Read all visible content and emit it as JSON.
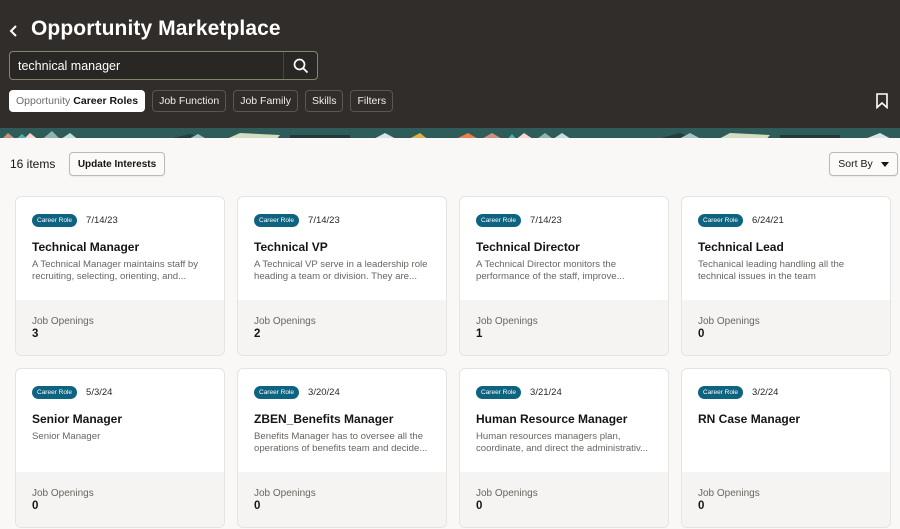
{
  "header": {
    "title": "Opportunity Marketplace",
    "back_icon": "chevron-left-icon",
    "bookmark_icon": "bookmark-icon",
    "background_color": "#312d2a"
  },
  "search": {
    "value": "technical manager",
    "icon": "search-icon"
  },
  "filters": [
    {
      "prefix": "Opportunity",
      "label": "Career Roles",
      "active": true
    },
    {
      "label": "Job Function",
      "active": false
    },
    {
      "label": "Job Family",
      "active": false
    },
    {
      "label": "Skills",
      "active": false
    },
    {
      "label": "Filters",
      "active": false
    }
  ],
  "toolbar": {
    "item_count": "16 items",
    "update_interests_label": "Update Interests",
    "sort_label": "Sort By"
  },
  "colors": {
    "badge": "#0d6380",
    "card_footer": "#f5f4f2"
  },
  "cards": [
    {
      "badge": "Career Role",
      "date": "7/14/23",
      "title": "Technical Manager",
      "description": "A Technical Manager maintains staff by recruiting, selecting, orienting, and...",
      "openings_label": "Job Openings",
      "openings": "3"
    },
    {
      "badge": "Career Role",
      "date": "7/14/23",
      "title": "Technical VP",
      "description": "A Technical VP serve in a leadership role heading a team or division. They are...",
      "openings_label": "Job Openings",
      "openings": "2"
    },
    {
      "badge": "Career Role",
      "date": "7/14/23",
      "title": "Technical Director",
      "description": "A Technical Director monitors the performance of the staff, improve...",
      "openings_label": "Job Openings",
      "openings": "1"
    },
    {
      "badge": "Career Role",
      "date": "6/24/21",
      "title": "Technical Lead",
      "description": "Techanical leading handling all the technical issues in the team",
      "openings_label": "Job Openings",
      "openings": "0"
    },
    {
      "badge": "Career Role",
      "date": "5/3/24",
      "title": "Senior Manager",
      "description": "Senior Manager",
      "openings_label": "Job Openings",
      "openings": "0"
    },
    {
      "badge": "Career Role",
      "date": "3/20/24",
      "title": "ZBEN_Benefits Manager",
      "description": "Benefits Manager has to oversee all the operations of benefits team and decide...",
      "openings_label": "Job Openings",
      "openings": "0"
    },
    {
      "badge": "Career Role",
      "date": "3/21/24",
      "title": "Human Resource Manager",
      "description": "Human resources managers plan, coordinate, and direct the administrativ...",
      "openings_label": "Job Openings",
      "openings": "0"
    },
    {
      "badge": "Career Role",
      "date": "3/2/24",
      "title": "RN Case Manager",
      "description": "",
      "openings_label": "Job Openings",
      "openings": "0"
    }
  ]
}
